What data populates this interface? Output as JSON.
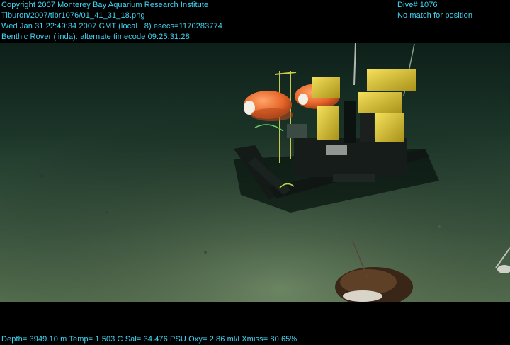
{
  "overlay": {
    "top_left_lines": [
      "Copyright 2007 Monterey Bay Aquarium Research Institute",
      "Tiburon/2007/tibr1076/01_41_31_18.png",
      "Wed Jan 31 22:49:34 2007 GMT (local +8)  esecs=1170283774",
      "Benthic Rover (linda): alternate timecode 09:25:31:28"
    ],
    "top_right_lines": [
      "Dive# 1076",
      "No match for position"
    ],
    "bottom_line": "Depth= 3949.10 m  Temp= 1.503 C  Sal= 34.476 PSU  Oxy= 2.86 ml/l  Xmiss= 80.65%"
  },
  "colors": {
    "hud_text": "#3fd6f4",
    "letterbox": "#000000",
    "seafloor_far": "#0f241c",
    "seafloor_near": "#4d6a4a",
    "float_orange": "#e8662a",
    "housing_yellow": "#d8c22a"
  },
  "scene": {
    "subject": "benthic-rover",
    "background": "deep-sea-seafloor"
  }
}
